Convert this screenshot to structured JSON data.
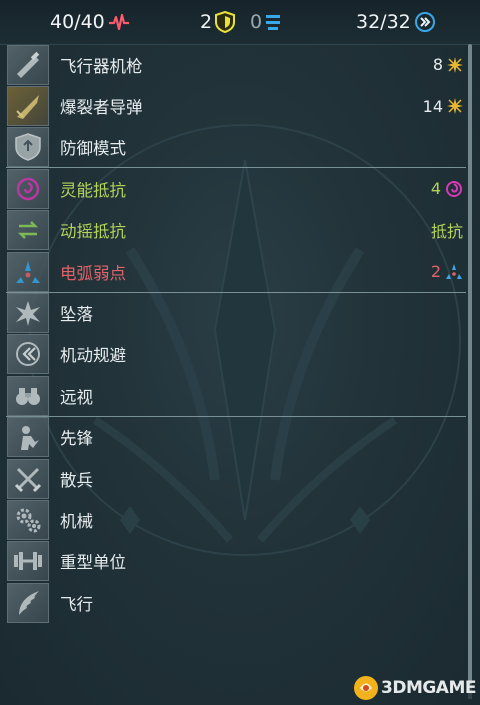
{
  "topbar": {
    "health": "40/40",
    "armor": "2",
    "shield": "0",
    "moves": "32/32"
  },
  "rows": [
    {
      "label": "飞行器机枪",
      "value": "8",
      "icon": "gun-icon",
      "value_icon": "star-burst-icon",
      "style": "normal"
    },
    {
      "label": "爆裂者导弹",
      "value": "14",
      "icon": "missile-icon",
      "value_icon": "star-burst-icon",
      "style": "normal"
    },
    {
      "label": "防御模式",
      "value": "",
      "icon": "shield-icon",
      "value_icon": "",
      "style": "normal"
    },
    {
      "label": "灵能抵抗",
      "value": "4",
      "icon": "psionic-icon",
      "value_icon": "spiral-icon",
      "style": "green"
    },
    {
      "label": "动摇抵抗",
      "value": "抵抗",
      "icon": "shake-icon",
      "value_icon": "",
      "style": "green"
    },
    {
      "label": "电弧弱点",
      "value": "2",
      "icon": "arc-icon",
      "value_icon": "arc-icon",
      "style": "red"
    },
    {
      "label": "坠落",
      "value": "",
      "icon": "fall-icon",
      "value_icon": "",
      "style": "normal"
    },
    {
      "label": "机动规避",
      "value": "",
      "icon": "evade-icon",
      "value_icon": "",
      "style": "normal"
    },
    {
      "label": "远视",
      "value": "",
      "icon": "binoculars-icon",
      "value_icon": "",
      "style": "normal"
    },
    {
      "label": "先锋",
      "value": "",
      "icon": "vanguard-icon",
      "value_icon": "",
      "style": "normal"
    },
    {
      "label": "散兵",
      "value": "",
      "icon": "crossed-swords-icon",
      "value_icon": "",
      "style": "normal"
    },
    {
      "label": "机械",
      "value": "",
      "icon": "gears-icon",
      "value_icon": "",
      "style": "normal"
    },
    {
      "label": "重型单位",
      "value": "",
      "icon": "dumbbell-icon",
      "value_icon": "",
      "style": "normal"
    },
    {
      "label": "飞行",
      "value": "",
      "icon": "wing-icon",
      "value_icon": "",
      "style": "normal"
    }
  ],
  "watermark": "3DMGAME",
  "colors": {
    "health": "#ff5a6e",
    "armor": "#e8e23a",
    "shield": "#3aa7e8",
    "moves": "#3aa7e8",
    "resist_green": "#b3d45a",
    "weak_red": "#e0636a",
    "damage_gold": "#e8b730",
    "psionic_pink": "#d33ab5"
  }
}
